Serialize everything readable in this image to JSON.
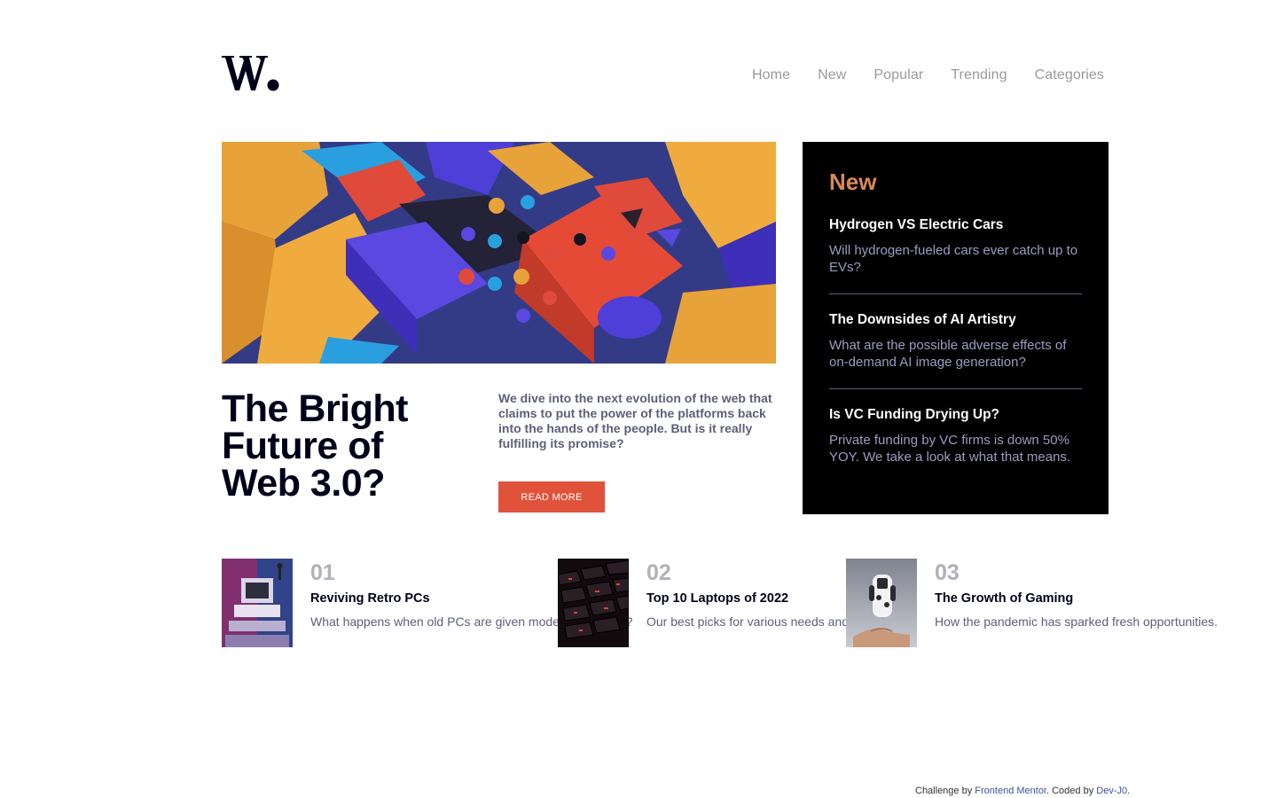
{
  "brand": {
    "logo_text": "W."
  },
  "nav": {
    "items": [
      "Home",
      "New",
      "Popular",
      "Trending",
      "Categories"
    ]
  },
  "hero": {
    "title": "The Bright Future of Web 3.0?",
    "description": "We dive into the next evolution of the web that claims to put the power of the platforms back into the hands of the people. But is it really fulfilling its promise?",
    "cta_label": "READ MORE"
  },
  "new_panel": {
    "heading": "New",
    "items": [
      {
        "title": "Hydrogen VS Electric Cars",
        "text": "Will hydrogen-fueled cars ever catch up to EVs?"
      },
      {
        "title": "The Downsides of AI Artistry",
        "text": "What are the possible adverse effects of on-demand AI image generation?"
      },
      {
        "title": "Is VC Funding Drying Up?",
        "text": "Private funding by VC firms is down 50% YOY. We take a look at what that means."
      }
    ]
  },
  "articles": [
    {
      "number": "01",
      "title": "Reviving Retro PCs",
      "text": "What happens when old PCs are given modern upgrades?"
    },
    {
      "number": "02",
      "title": "Top 10 Laptops of 2022",
      "text": "Our best picks for various needs and budgets."
    },
    {
      "number": "03",
      "title": "The Growth of Gaming",
      "text": "How the pandemic has sparked fresh opportunities."
    }
  ],
  "footer": {
    "prefix": "Challenge by ",
    "challenge_link": "Frontend Mentor",
    "middle": ". Coded by ",
    "author_link": "Dev-J0",
    "suffix": "."
  },
  "colors": {
    "accent": "#e0533a",
    "new_heading": "#d68a55",
    "dark": "#00001a",
    "muted": "#5d5f79"
  }
}
